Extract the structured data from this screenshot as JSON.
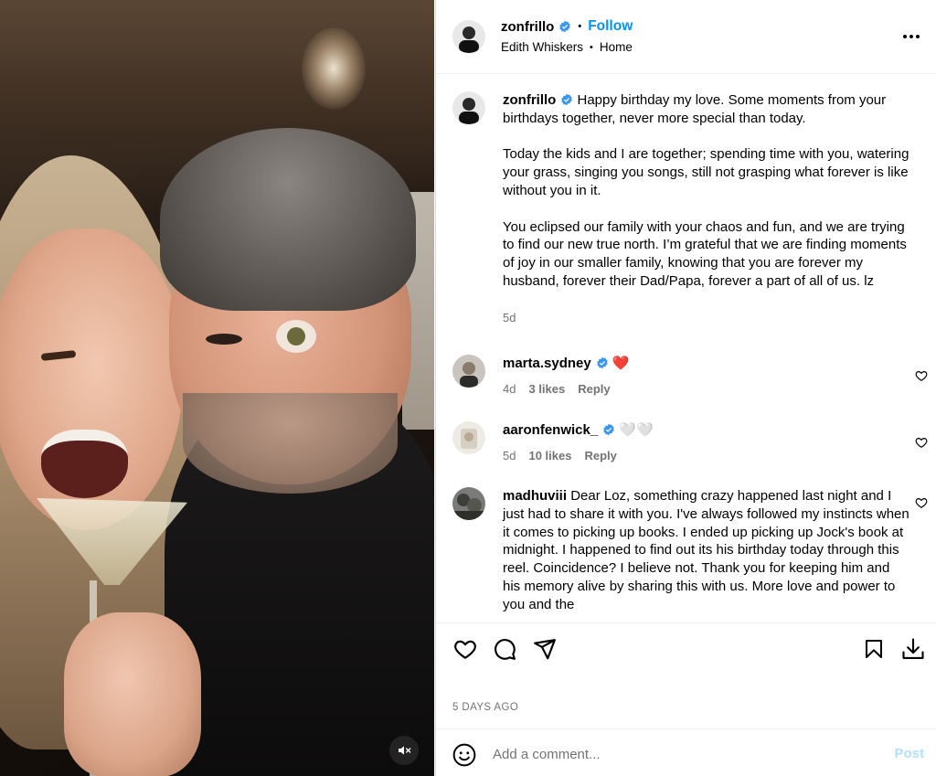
{
  "colors": {
    "accent": "#0095f6",
    "verified": "#3897f0",
    "muted_text": "#737373",
    "post_disabled": "#b2dffc",
    "heart_red": "#ed1c24"
  },
  "media": {
    "mute_icon": "speaker-muted-icon"
  },
  "post_header": {
    "username": "zonfrillo",
    "follow_label": "Follow",
    "audio": "Edith Whiskers",
    "location": "Home",
    "more_icon": "more-options-icon"
  },
  "caption": {
    "username": "zonfrillo",
    "paragraphs": [
      "Happy birthday my love. Some moments from your birthdays together, never more special than today.",
      "Today the kids and I are together; spending time with you, watering your grass, singing you songs, still not grasping what forever is like without you in it.",
      "You eclipsed our family with your chaos and fun, and we are trying to find our new true north. I’m grateful that we are finding moments of joy in our smaller family, knowing that you are forever my husband, forever their Dad/Papa, forever a part of all of us. lz"
    ],
    "time": "5d"
  },
  "comments": [
    {
      "username": "marta.sydney",
      "verified": true,
      "text": "❤️",
      "time": "4d",
      "likes": "3 likes",
      "reply": "Reply"
    },
    {
      "username": "aaronfenwick_",
      "verified": true,
      "text": "🤍🤍",
      "time": "5d",
      "likes": "10 likes",
      "reply": "Reply"
    },
    {
      "username": "madhuviii",
      "verified": false,
      "text": "Dear Loz, something crazy happened last night and I just had to share it with you. I've always followed my instincts when it comes to picking up books. I ended up picking up Jock's book at midnight. I happened to find out its his birthday today through this reel. Coincidence? I believe not. Thank you for keeping him and his memory alive by sharing this with us. More love and power to you and the"
    }
  ],
  "actions": {
    "like_icon": "heart-icon",
    "comment_icon": "comment-icon",
    "share_icon": "paper-plane-icon",
    "save_icon": "bookmark-icon",
    "download_icon": "download-icon"
  },
  "post_date": "5 DAYS AGO",
  "add_comment": {
    "placeholder": "Add a comment...",
    "post_label": "Post",
    "emoji_icon": "smiley-icon"
  }
}
